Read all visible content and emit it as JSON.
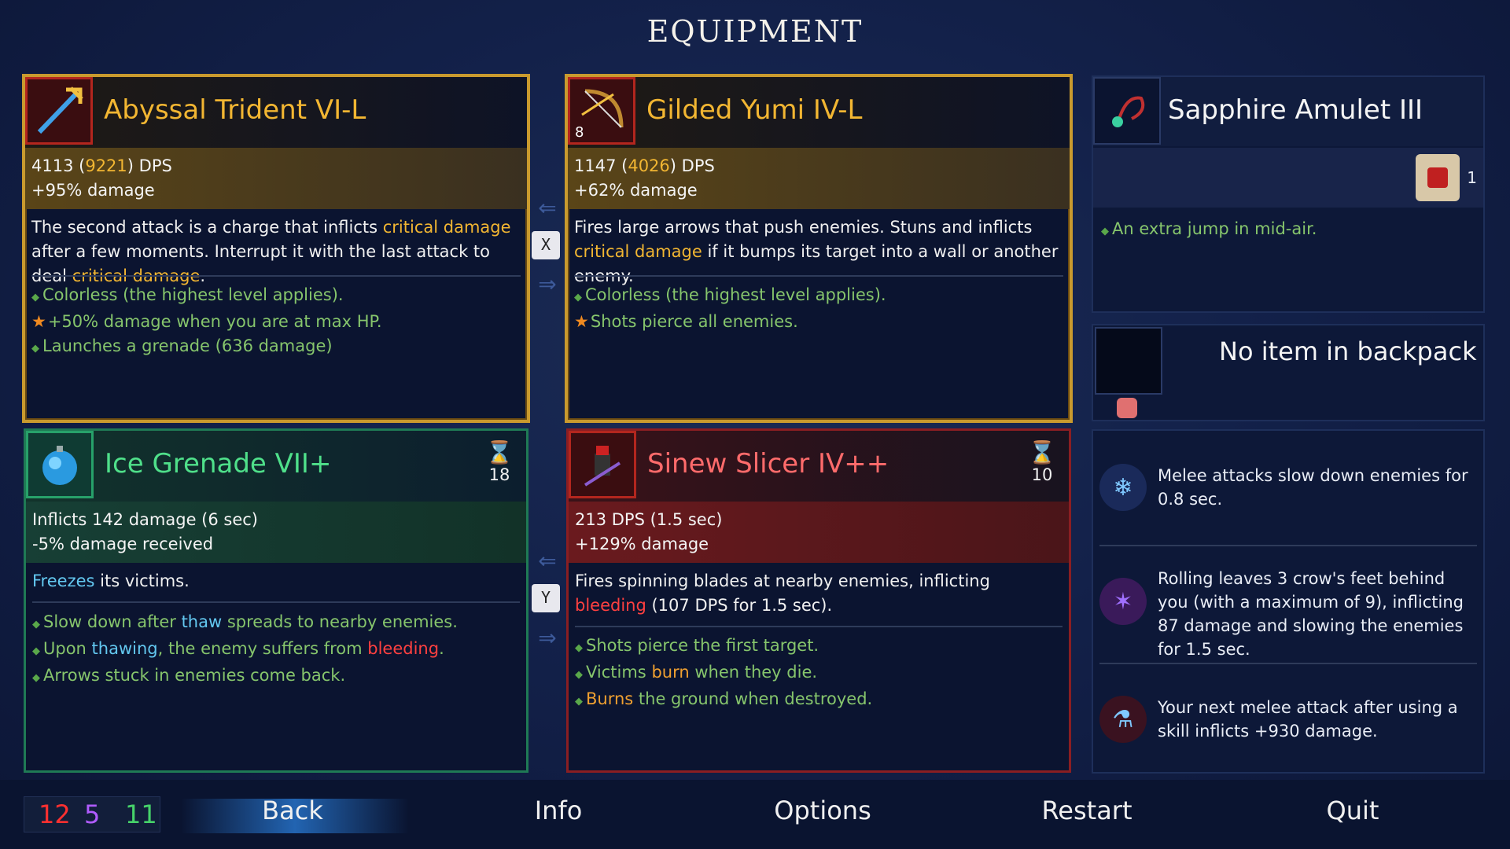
{
  "title": "EQUIPMENT",
  "weapons": {
    "primary": {
      "name": "Abyssal Trident VI-L",
      "dps": "4113",
      "dps_alt": "9221",
      "dps_label": "DPS",
      "stat2": "+95% damage",
      "desc_a": "The second attack is a charge that inflicts ",
      "desc_hl1": "critical damage",
      "desc_b": " after a few moments. Interrupt it with the last attack to deal ",
      "desc_hl2": "critical damage",
      "desc_c": ".",
      "bullets": [
        "Colorless (the highest level applies).",
        "+50% damage when you are at max HP.",
        "Launches a grenade (636 damage)"
      ],
      "icon": "trident-icon"
    },
    "secondary": {
      "name": "Gilded Yumi IV-L",
      "level_badge": "8",
      "dps": "1147",
      "dps_alt": "4026",
      "dps_label": "DPS",
      "stat2": "+62% damage",
      "desc_a": "Fires large arrows that push enemies. Stuns and inflicts ",
      "desc_hl1": "critical damage",
      "desc_b": " if it bumps its target into a wall or another enemy.",
      "bullets": [
        "Colorless (the highest level applies).",
        "Shots pierce all enemies."
      ],
      "icon": "bow-icon"
    }
  },
  "skills": {
    "left": {
      "name": "Ice Grenade VII+",
      "cooldown": "18",
      "stat1": "Inflicts 142 damage (6 sec)",
      "stat2": "-5% damage received",
      "desc_hl": "Freezes",
      "desc_rest": " its victims.",
      "b1_a": "Slow down after ",
      "b1_hl": "thaw",
      "b1_b": " spreads to nearby enemies.",
      "b2_a": "Upon ",
      "b2_hl": "thawing",
      "b2_b": ", the enemy suffers from ",
      "b2_hl2": "bleeding",
      "b2_c": ".",
      "b3": "Arrows stuck in enemies come back.",
      "icon": "ice-grenade-icon"
    },
    "right": {
      "name": "Sinew Slicer IV++",
      "cooldown": "10",
      "stat1": "213 DPS (1.5 sec)",
      "stat2": "+129% damage",
      "desc_a": "Fires spinning blades at nearby enemies, inflicting ",
      "desc_hl": "bleeding",
      "desc_b": " (107 DPS for 1.5 sec).",
      "b1": "Shots pierce the first target.",
      "b2_a": "Victims ",
      "b2_hl": "burn",
      "b2_b": " when they die.",
      "b3_hl": "Burns",
      "b3_b": " the ground when destroyed.",
      "icon": "sinew-slicer-icon"
    }
  },
  "swap_keys": {
    "weapons": "X",
    "skills": "Y"
  },
  "amulet": {
    "name": "Sapphire Amulet III",
    "scroll_count": "1",
    "bullet": "An extra jump in mid-air.",
    "icon": "amulet-icon"
  },
  "backpack": {
    "label": "No item in backpack"
  },
  "mutations": [
    {
      "text": "Melee attacks slow down enemies for 0.8 sec.",
      "icon": "frost-blade-icon"
    },
    {
      "text": "Rolling leaves 3 crow's feet behind you (with a maximum of 9), inflicting 87 damage and slowing the enemies for 1.5 sec.",
      "icon": "crows-feet-icon"
    },
    {
      "text": "Your next melee attack after using a skill inflicts +930 damage.",
      "icon": "combo-potion-icon"
    }
  ],
  "scrolls": {
    "brutality": "12",
    "tactics": "5",
    "survival": "11"
  },
  "colors": {
    "brutality": "#ff3030",
    "tactics": "#b05cff",
    "survival": "#46d26a",
    "gold": "#f2b632"
  },
  "nav": {
    "back": "Back",
    "info": "Info",
    "options": "Options",
    "restart": "Restart",
    "quit": "Quit"
  }
}
